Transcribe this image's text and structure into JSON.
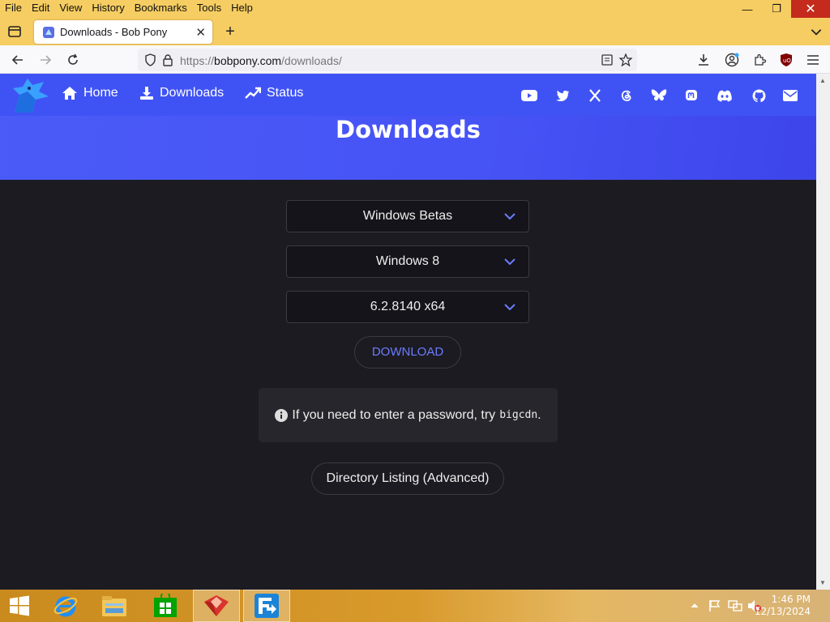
{
  "browser": {
    "menu": [
      "File",
      "Edit",
      "View",
      "History",
      "Bookmarks",
      "Tools",
      "Help"
    ],
    "tab_title": "Downloads - Bob Pony",
    "url_prefix": "https://",
    "url_domain": "bobpony.com",
    "url_path": "/downloads/"
  },
  "site": {
    "nav": [
      {
        "label": "Home",
        "icon": "home-icon"
      },
      {
        "label": "Downloads",
        "icon": "download-icon"
      },
      {
        "label": "Status",
        "icon": "trending-up-icon"
      }
    ],
    "social_icons": [
      "youtube-icon",
      "twitter-icon",
      "x-icon",
      "threads-icon",
      "bluesky-icon",
      "mastodon-icon",
      "discord-icon",
      "github-icon",
      "email-icon"
    ],
    "page_title": "Downloads",
    "selects": {
      "category": "Windows Betas",
      "product": "Windows 8",
      "build": "6.2.8140 x64"
    },
    "download_label": "DOWNLOAD",
    "notice_text": "If you need to enter a password, try",
    "notice_password": "bigcdn",
    "notice_suffix": ".",
    "directory_label": "Directory Listing (Advanced)",
    "accent_color": "#4653f5"
  },
  "taskbar": {
    "apps": [
      "start-icon",
      "internet-explorer-icon",
      "file-explorer-icon",
      "store-icon",
      "app-icon",
      "app-icon"
    ],
    "time": "1:46 PM",
    "date": "12/13/2024"
  }
}
